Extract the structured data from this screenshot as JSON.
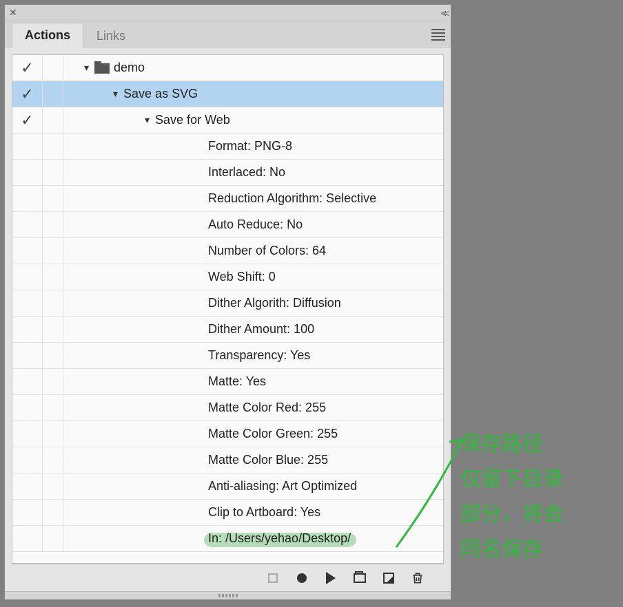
{
  "tabs": {
    "actions": "Actions",
    "links": "Links"
  },
  "tree": {
    "root": {
      "label": "demo"
    },
    "action1": {
      "label": "Save as SVG"
    },
    "action2": {
      "label": "Save for Web"
    },
    "params": [
      "Format: PNG-8",
      "Interlaced: No",
      "Reduction Algorithm: Selective",
      "Auto Reduce: No",
      "Number of Colors: 64",
      "Web Shift: 0",
      "Dither Algorith: Diffusion",
      "Dither Amount: 100",
      "Transparency: Yes",
      "Matte: Yes",
      "Matte Color Red: 255",
      "Matte Color Green: 255",
      "Matte Color Blue: 255",
      "Anti-aliasing: Art Optimized",
      "Clip to Artboard: Yes",
      "In: /Users/yehao/Desktop/"
    ]
  },
  "annotation": {
    "line1": "保存路径",
    "line2": "仅留下目录",
    "line3": "部分，将会",
    "line4": "同名保存"
  }
}
